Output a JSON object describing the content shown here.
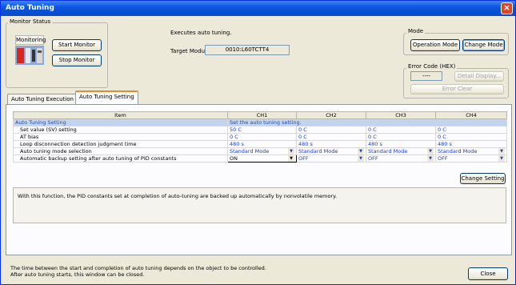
{
  "window": {
    "title": "Auto Tuning",
    "close_glyph": "×"
  },
  "monitor_status": {
    "label": "Monitor Status",
    "state": "Monitoring",
    "start_button": "Start Monitor",
    "stop_button": "Stop Monitor"
  },
  "header": {
    "description": "Executes auto tuning.",
    "target_module_label": "Target Module",
    "target_module_value": "0010:L60TCTT4"
  },
  "mode": {
    "label": "Mode",
    "operation_button": "Operation Mode",
    "change_button": "Change Mode"
  },
  "error_code": {
    "label": "Error Code (HEX)",
    "value": "----",
    "detail_button": "Detail Display...",
    "clear_button": "Error Clear"
  },
  "tabs": [
    {
      "label": "Auto Tuning Execution",
      "active": false
    },
    {
      "label": "Auto Tuning Setting",
      "active": true
    }
  ],
  "grid": {
    "headers": [
      "Item",
      "CH1",
      "CH2",
      "CH3",
      "CH4"
    ],
    "section_row": {
      "label": "Auto Tuning Setting",
      "note": "Set the auto tuning setting."
    },
    "rows": [
      {
        "label": "Set value (SV) setting",
        "values": [
          "50 C",
          "0 C",
          "0 C",
          "0 C"
        ]
      },
      {
        "label": "AT bias",
        "values": [
          "0 C",
          "0 C",
          "0 C",
          "0 C"
        ]
      },
      {
        "label": "Loop disconnection detection judgment time",
        "values": [
          "480 s",
          "480 s",
          "480 s",
          "480 s"
        ]
      },
      {
        "label": "Auto tuning mode selection",
        "values": [
          "Standard Mode",
          "Standard Mode",
          "Standard Mode",
          "Standard Mode"
        ]
      },
      {
        "label": "Automatic backup setting after auto tuning of PID constants",
        "values": [
          "ON",
          "OFF",
          "OFF",
          "OFF"
        ]
      }
    ]
  },
  "change_setting_button": "Change Setting",
  "info_text": "With this function, the PID constants set at completion of auto-tuning are backed up automatically by nonvolatile memory.",
  "footer": {
    "line1": "The time between the start and completion of auto tuning depends on the object to be controlled.",
    "line2": "After auto tuning starts, this window can be closed.",
    "close_button": "Close"
  },
  "colors": {
    "titlebar": "#0a4bc8",
    "section_row": "#c3d4f0",
    "value_text": "#1f3fbf",
    "active_tab_accent": "#e68b2c"
  }
}
